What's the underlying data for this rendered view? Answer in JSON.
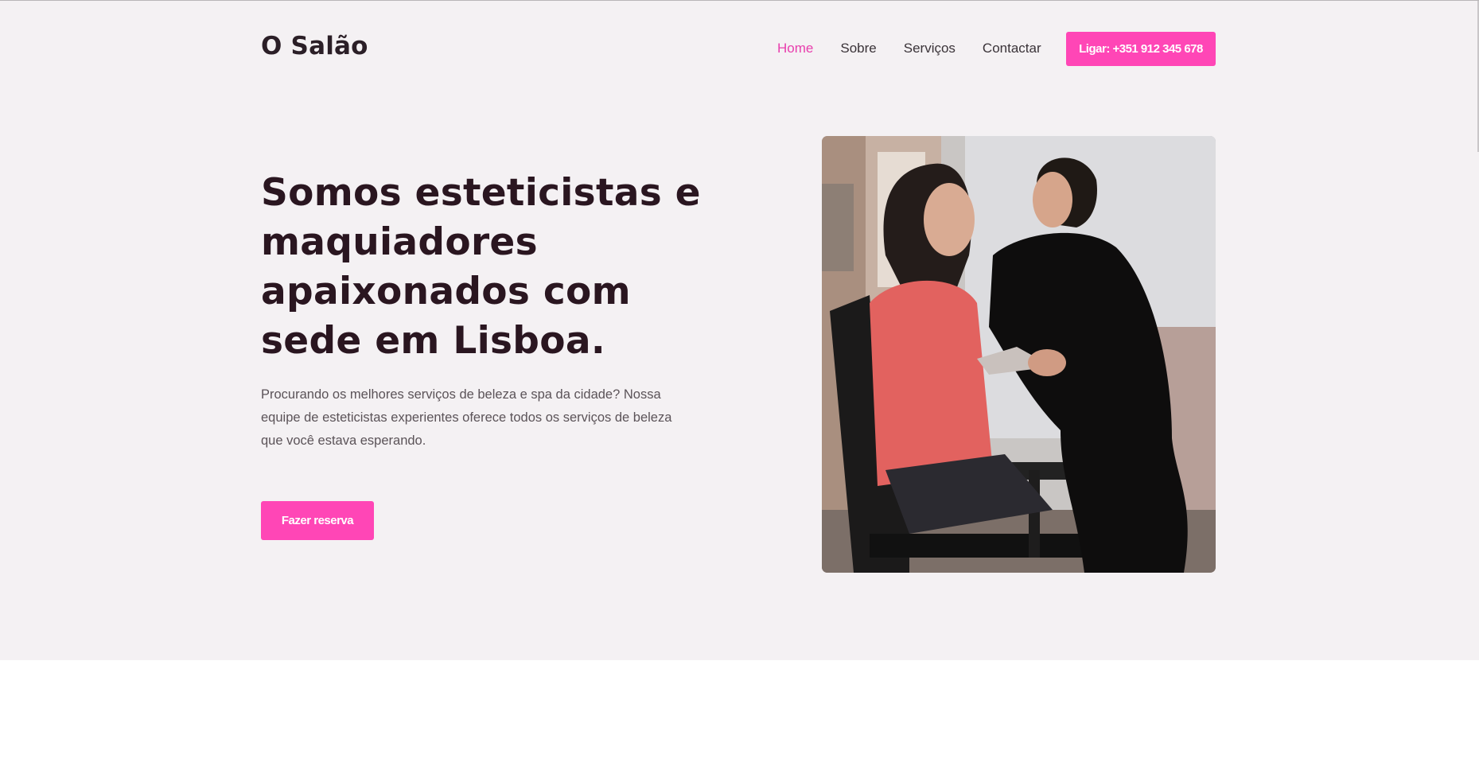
{
  "header": {
    "logo": "O Salão",
    "nav": [
      {
        "label": "Home",
        "active": true
      },
      {
        "label": "Sobre",
        "active": false
      },
      {
        "label": "Serviços",
        "active": false
      },
      {
        "label": "Contactar",
        "active": false
      }
    ],
    "call_button": "Ligar: +351 912 345 678"
  },
  "hero": {
    "headline": "Somos esteticistas e maquiadores apaixonados com sede em Lisboa.",
    "description": "Procurando os melhores serviços de beleza e spa da cidade? Nossa equipe de esteticistas experientes oferece todos os serviços de beleza que você estava esperando.",
    "cta": "Fazer reserva",
    "image": "beautician applying makeup to a seated client in a salon"
  },
  "colors": {
    "accent": "#ff46b6",
    "active_nav": "#e83ead",
    "hero_background": "#f4f1f3",
    "headline": "#2a1620"
  }
}
